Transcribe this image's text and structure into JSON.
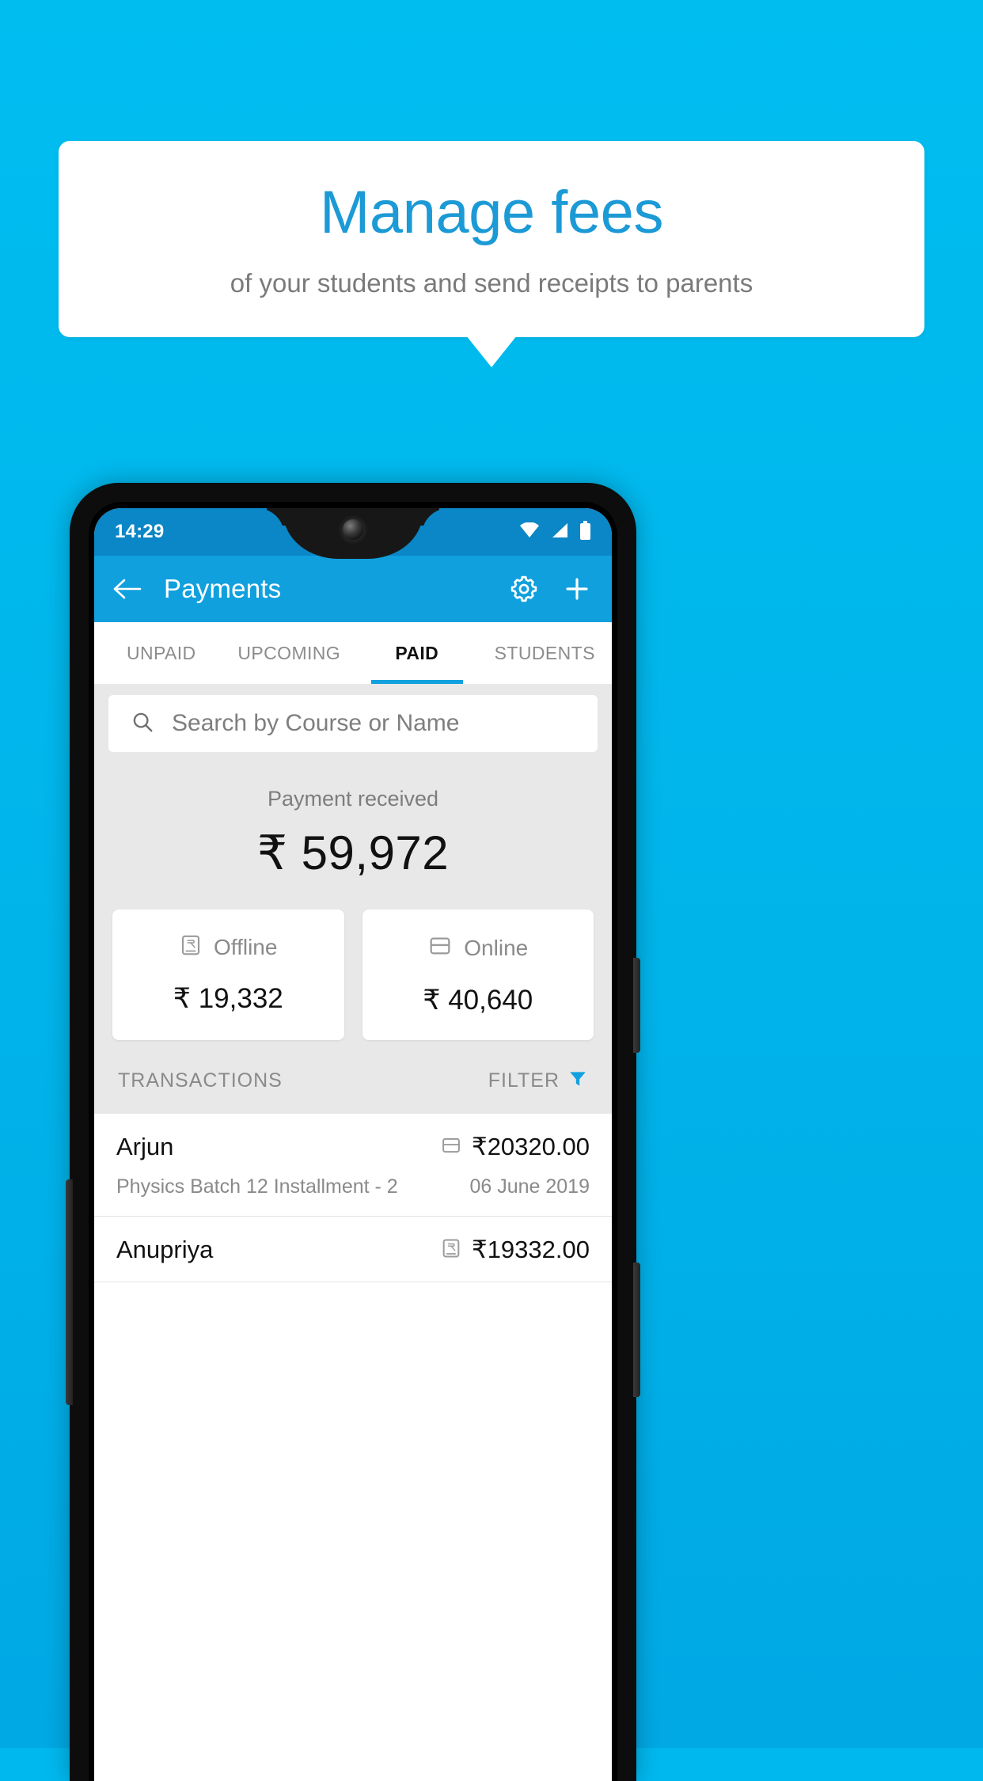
{
  "promo": {
    "title": "Manage fees",
    "subtitle": "of your students and send receipts to parents",
    "background_color": "#00b8ee",
    "title_color": "#1c9ad6",
    "bubble_color": "#ffffff"
  },
  "phone": {
    "status_bar": {
      "time": "14:29",
      "icons": [
        "wifi-icon",
        "signal-icon",
        "battery-icon"
      ],
      "background_color": "#0b86c6"
    },
    "app_bar": {
      "back_icon": "back-arrow-icon",
      "title": "Payments",
      "settings_icon": "gear-icon",
      "add_icon": "plus-icon",
      "background_color": "#11a0de"
    },
    "tabs": [
      {
        "label": "UNPAID",
        "active": false
      },
      {
        "label": "UPCOMING",
        "active": false
      },
      {
        "label": "PAID",
        "active": true
      },
      {
        "label": "STUDENTS",
        "active": false
      }
    ],
    "tab_indicator_color": "#11a0de",
    "search": {
      "icon": "search-icon",
      "placeholder": "Search by Course or Name",
      "value": ""
    },
    "summary": {
      "label": "Payment received",
      "amount": "₹ 59,972"
    },
    "methods": [
      {
        "icon": "rupee-note-icon",
        "name": "Offline",
        "amount": "₹ 19,332"
      },
      {
        "icon": "credit-card-icon",
        "name": "Online",
        "amount": "₹ 40,640"
      }
    ],
    "list_header": {
      "title": "TRANSACTIONS",
      "filter_label": "FILTER",
      "filter_icon": "funnel-icon",
      "filter_icon_color": "#11a0de"
    },
    "transactions": [
      {
        "name": "Arjun",
        "description": "Physics Batch 12 Installment - 2",
        "amount": "₹20320.00",
        "date": "06 June 2019",
        "method_icon": "credit-card-icon"
      },
      {
        "name": "Anupriya",
        "description": "",
        "amount": "₹19332.00",
        "date": "",
        "method_icon": "rupee-note-icon"
      }
    ]
  }
}
